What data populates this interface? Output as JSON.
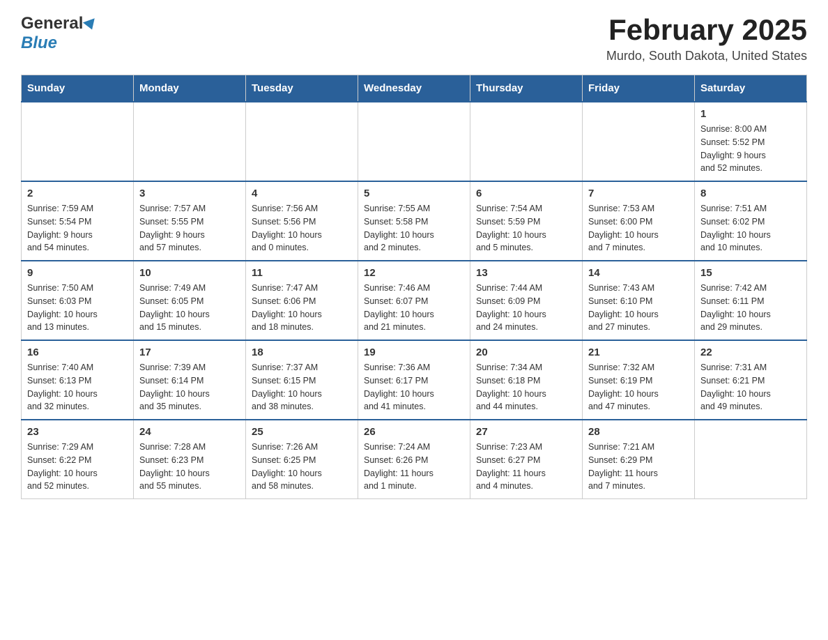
{
  "header": {
    "logo": {
      "general": "General",
      "blue": "Blue"
    },
    "title": "February 2025",
    "subtitle": "Murdo, South Dakota, United States"
  },
  "weekdays": [
    "Sunday",
    "Monday",
    "Tuesday",
    "Wednesday",
    "Thursday",
    "Friday",
    "Saturday"
  ],
  "weeks": [
    [
      {
        "day": "",
        "info": ""
      },
      {
        "day": "",
        "info": ""
      },
      {
        "day": "",
        "info": ""
      },
      {
        "day": "",
        "info": ""
      },
      {
        "day": "",
        "info": ""
      },
      {
        "day": "",
        "info": ""
      },
      {
        "day": "1",
        "info": "Sunrise: 8:00 AM\nSunset: 5:52 PM\nDaylight: 9 hours\nand 52 minutes."
      }
    ],
    [
      {
        "day": "2",
        "info": "Sunrise: 7:59 AM\nSunset: 5:54 PM\nDaylight: 9 hours\nand 54 minutes."
      },
      {
        "day": "3",
        "info": "Sunrise: 7:57 AM\nSunset: 5:55 PM\nDaylight: 9 hours\nand 57 minutes."
      },
      {
        "day": "4",
        "info": "Sunrise: 7:56 AM\nSunset: 5:56 PM\nDaylight: 10 hours\nand 0 minutes."
      },
      {
        "day": "5",
        "info": "Sunrise: 7:55 AM\nSunset: 5:58 PM\nDaylight: 10 hours\nand 2 minutes."
      },
      {
        "day": "6",
        "info": "Sunrise: 7:54 AM\nSunset: 5:59 PM\nDaylight: 10 hours\nand 5 minutes."
      },
      {
        "day": "7",
        "info": "Sunrise: 7:53 AM\nSunset: 6:00 PM\nDaylight: 10 hours\nand 7 minutes."
      },
      {
        "day": "8",
        "info": "Sunrise: 7:51 AM\nSunset: 6:02 PM\nDaylight: 10 hours\nand 10 minutes."
      }
    ],
    [
      {
        "day": "9",
        "info": "Sunrise: 7:50 AM\nSunset: 6:03 PM\nDaylight: 10 hours\nand 13 minutes."
      },
      {
        "day": "10",
        "info": "Sunrise: 7:49 AM\nSunset: 6:05 PM\nDaylight: 10 hours\nand 15 minutes."
      },
      {
        "day": "11",
        "info": "Sunrise: 7:47 AM\nSunset: 6:06 PM\nDaylight: 10 hours\nand 18 minutes."
      },
      {
        "day": "12",
        "info": "Sunrise: 7:46 AM\nSunset: 6:07 PM\nDaylight: 10 hours\nand 21 minutes."
      },
      {
        "day": "13",
        "info": "Sunrise: 7:44 AM\nSunset: 6:09 PM\nDaylight: 10 hours\nand 24 minutes."
      },
      {
        "day": "14",
        "info": "Sunrise: 7:43 AM\nSunset: 6:10 PM\nDaylight: 10 hours\nand 27 minutes."
      },
      {
        "day": "15",
        "info": "Sunrise: 7:42 AM\nSunset: 6:11 PM\nDaylight: 10 hours\nand 29 minutes."
      }
    ],
    [
      {
        "day": "16",
        "info": "Sunrise: 7:40 AM\nSunset: 6:13 PM\nDaylight: 10 hours\nand 32 minutes."
      },
      {
        "day": "17",
        "info": "Sunrise: 7:39 AM\nSunset: 6:14 PM\nDaylight: 10 hours\nand 35 minutes."
      },
      {
        "day": "18",
        "info": "Sunrise: 7:37 AM\nSunset: 6:15 PM\nDaylight: 10 hours\nand 38 minutes."
      },
      {
        "day": "19",
        "info": "Sunrise: 7:36 AM\nSunset: 6:17 PM\nDaylight: 10 hours\nand 41 minutes."
      },
      {
        "day": "20",
        "info": "Sunrise: 7:34 AM\nSunset: 6:18 PM\nDaylight: 10 hours\nand 44 minutes."
      },
      {
        "day": "21",
        "info": "Sunrise: 7:32 AM\nSunset: 6:19 PM\nDaylight: 10 hours\nand 47 minutes."
      },
      {
        "day": "22",
        "info": "Sunrise: 7:31 AM\nSunset: 6:21 PM\nDaylight: 10 hours\nand 49 minutes."
      }
    ],
    [
      {
        "day": "23",
        "info": "Sunrise: 7:29 AM\nSunset: 6:22 PM\nDaylight: 10 hours\nand 52 minutes."
      },
      {
        "day": "24",
        "info": "Sunrise: 7:28 AM\nSunset: 6:23 PM\nDaylight: 10 hours\nand 55 minutes."
      },
      {
        "day": "25",
        "info": "Sunrise: 7:26 AM\nSunset: 6:25 PM\nDaylight: 10 hours\nand 58 minutes."
      },
      {
        "day": "26",
        "info": "Sunrise: 7:24 AM\nSunset: 6:26 PM\nDaylight: 11 hours\nand 1 minute."
      },
      {
        "day": "27",
        "info": "Sunrise: 7:23 AM\nSunset: 6:27 PM\nDaylight: 11 hours\nand 4 minutes."
      },
      {
        "day": "28",
        "info": "Sunrise: 7:21 AM\nSunset: 6:29 PM\nDaylight: 11 hours\nand 7 minutes."
      },
      {
        "day": "",
        "info": ""
      }
    ]
  ]
}
